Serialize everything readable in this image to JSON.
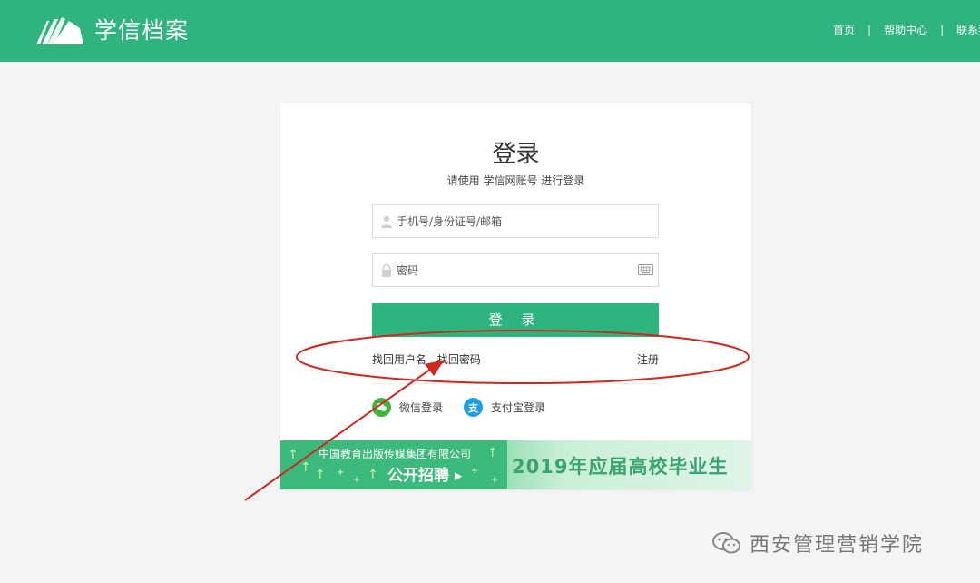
{
  "header": {
    "site_title": "学信档案",
    "nav": [
      {
        "label": "首页"
      },
      {
        "label": "帮助中心"
      },
      {
        "label": "联系我"
      }
    ],
    "separator": "|",
    "brand_color": "#2fb37f"
  },
  "login": {
    "title": "登录",
    "subtitle": "请使用 学信网账号 进行登录",
    "username_placeholder": "手机号/身份证号/邮箱",
    "password_placeholder": "密码",
    "submit_label": "登 录",
    "find_username": "找回用户名",
    "find_password": "找回密码",
    "register": "注册",
    "wechat_login": "微信登录",
    "alipay_login": "支付宝登录",
    "alipay_glyph": "支"
  },
  "banner": {
    "line1": "中国教育出版传媒集团有限公司",
    "line2": "公开招聘 ▸",
    "right_text": "2019年应届高校毕业生"
  },
  "annotation": {
    "color": "#cc2a20"
  },
  "watermark": {
    "text": "西安管理营销学院"
  }
}
